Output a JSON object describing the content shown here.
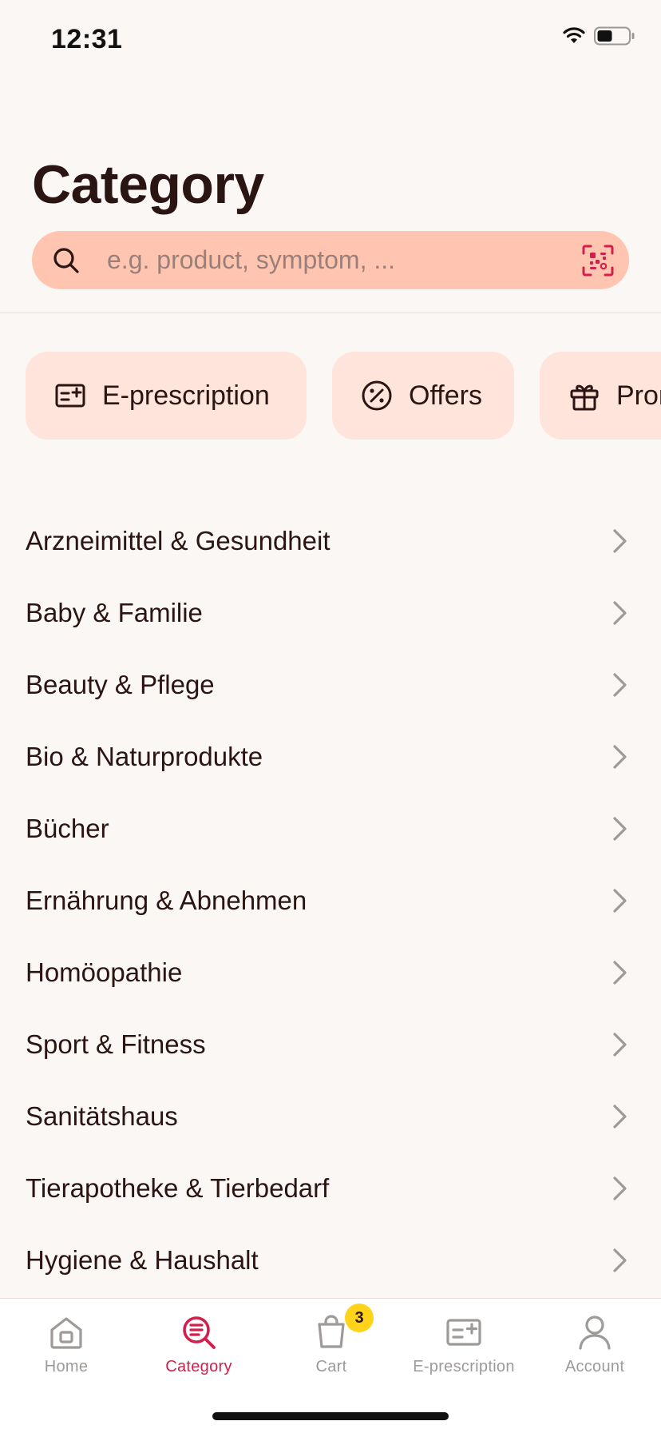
{
  "status_bar": {
    "time": "12:31"
  },
  "page": {
    "title": "Category"
  },
  "search": {
    "placeholder": "e.g. product, symptom, ...",
    "value": ""
  },
  "quick_links": [
    {
      "label": "E-prescription",
      "icon": "prescription-icon"
    },
    {
      "label": "Offers",
      "icon": "percent-icon"
    },
    {
      "label": "Promotions",
      "icon": "gift-icon"
    }
  ],
  "categories": [
    {
      "label": "Arzneimittel & Gesundheit"
    },
    {
      "label": "Baby & Familie"
    },
    {
      "label": "Beauty & Pflege"
    },
    {
      "label": "Bio & Naturprodukte"
    },
    {
      "label": "Bücher"
    },
    {
      "label": "Ernährung & Abnehmen"
    },
    {
      "label": "Homöopathie"
    },
    {
      "label": "Sport & Fitness"
    },
    {
      "label": "Sanitätshaus"
    },
    {
      "label": "Tierapotheke & Tierbedarf"
    },
    {
      "label": "Hygiene & Haushalt"
    }
  ],
  "tab_bar": {
    "active": "Category",
    "tabs": [
      {
        "label": "Home",
        "icon": "home-icon"
      },
      {
        "label": "Category",
        "icon": "category-search-icon"
      },
      {
        "label": "Cart",
        "icon": "bag-icon",
        "badge": "3"
      },
      {
        "label": "E-prescription",
        "icon": "prescription-icon"
      },
      {
        "label": "Account",
        "icon": "person-icon"
      }
    ]
  },
  "colors": {
    "background": "#faf7f5",
    "search_background": "#ffc5b0",
    "chip_background": "#ffe4dc",
    "accent": "#d21f4c",
    "text": "#2b1512",
    "badge": "#ffd31a"
  }
}
